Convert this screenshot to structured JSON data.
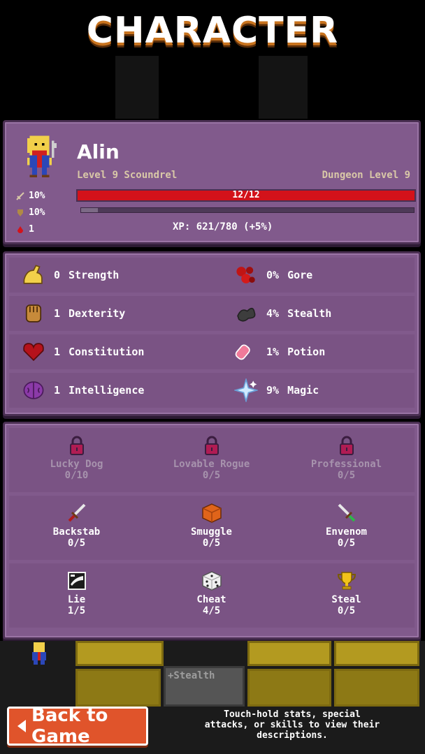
{
  "screen_title": "CHARACTER",
  "player": {
    "name": "Alin",
    "level_text": "Level 9 Scoundrel",
    "dungeon_level_text": "Dungeon Level 9",
    "attack_pct": "10%",
    "defense_pct": "10%",
    "blood": "1",
    "hp_text": "12/12",
    "hp_fraction": 1.0,
    "xp_text": "XP: 621/780 (+5%)",
    "xp_fraction": 0.05
  },
  "stats": [
    {
      "left": {
        "icon": "strength-arm-icon",
        "value": "0",
        "label": "Strength"
      },
      "right": {
        "icon": "gore-icon",
        "value": "0%",
        "label": "Gore"
      }
    },
    {
      "left": {
        "icon": "dexterity-fist-icon",
        "value": "1",
        "label": "Dexterity"
      },
      "right": {
        "icon": "stealth-smoke-icon",
        "value": "4%",
        "label": "Stealth"
      }
    },
    {
      "left": {
        "icon": "constitution-heart-icon",
        "value": "1",
        "label": "Constitution"
      },
      "right": {
        "icon": "potion-icon",
        "value": "1%",
        "label": "Potion"
      }
    },
    {
      "left": {
        "icon": "intelligence-brain-icon",
        "value": "1",
        "label": "Intelligence"
      },
      "right": {
        "icon": "magic-sparkle-icon",
        "value": "9%",
        "label": "Magic"
      }
    }
  ],
  "skills": [
    [
      {
        "name": "Lucky Dog",
        "level": "0/10",
        "icon": "lock-icon",
        "locked": true
      },
      {
        "name": "Lovable Rogue",
        "level": "0/5",
        "icon": "lock-icon",
        "locked": true
      },
      {
        "name": "Professional",
        "level": "0/5",
        "icon": "lock-icon",
        "locked": true
      }
    ],
    [
      {
        "name": "Backstab",
        "level": "0/5",
        "icon": "dagger-icon",
        "locked": false
      },
      {
        "name": "Smuggle",
        "level": "0/5",
        "icon": "crate-icon",
        "locked": false
      },
      {
        "name": "Envenom",
        "level": "0/5",
        "icon": "poison-dagger-icon",
        "locked": false
      }
    ],
    [
      {
        "name": "Lie",
        "level": "1/5",
        "icon": "mask-icon",
        "locked": false
      },
      {
        "name": "Cheat",
        "level": "4/5",
        "icon": "dice-icon",
        "locked": false
      },
      {
        "name": "Steal",
        "level": "0/5",
        "icon": "trophy-icon",
        "locked": false
      }
    ]
  ],
  "background": {
    "ghost_text": "+Stealth"
  },
  "back_button": "Back to Game",
  "hint_lines": [
    "Touch-hold stats, special",
    "attacks, or skills to view their",
    "descriptions."
  ],
  "colors": {
    "panel": "#815a8c",
    "hp": "#d3121a",
    "button": "#e0542b"
  }
}
